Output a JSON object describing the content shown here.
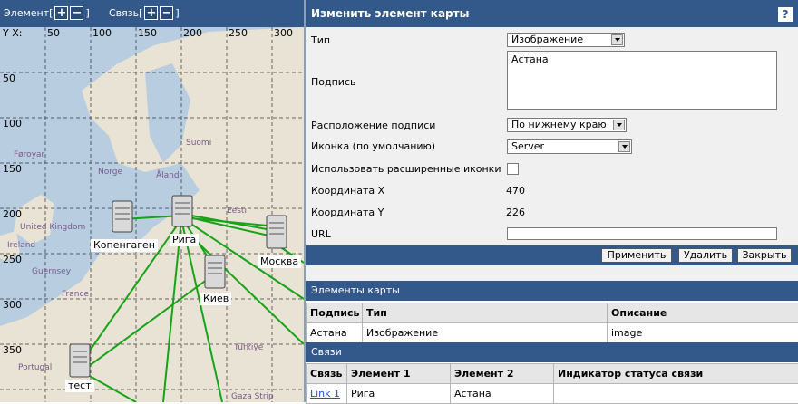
{
  "toolbar": {
    "element_label": "Элемент[",
    "element_add": "+",
    "element_remove": "−",
    "element_close": "]",
    "link_label": "Связь[",
    "link_add": "+",
    "link_remove": "−",
    "link_close": "]"
  },
  "map": {
    "corner_label": "Y X:",
    "x_ticks": [
      "50",
      "100",
      "150",
      "200",
      "250",
      "300"
    ],
    "y_ticks": [
      "50",
      "100",
      "150",
      "200",
      "250",
      "300",
      "350"
    ],
    "place_names": [
      "Føroyar",
      "Norge",
      "Suomi",
      "Eesti",
      "Åland",
      "United Kingdom",
      "Ireland",
      "France",
      "Guernsey",
      "Türkiye",
      "Portugal",
      "Gaza Strip"
    ],
    "nodes": [
      {
        "label": "Копенгаген"
      },
      {
        "label": "Рига"
      },
      {
        "label": "Москва"
      },
      {
        "label": "Киев"
      },
      {
        "label": "тест"
      }
    ]
  },
  "editor": {
    "title": "Изменить элемент карты",
    "help": "?",
    "type_label": "Тип",
    "type_value": "Изображение",
    "caption_label": "Подпись",
    "caption_value": "Астана",
    "caption_pos_label": "Расположение подписи",
    "caption_pos_value": "По нижнему краю",
    "icon_label": "Иконка (по умолчанию)",
    "icon_value": "Server",
    "advanced_icons_label": "Использовать расширенные иконки",
    "x_label": "Координата X",
    "x_value": "470",
    "y_label": "Координата Y",
    "y_value": "226",
    "url_label": "URL",
    "apply": "Применить",
    "delete": "Удалить",
    "close": "Закрыть"
  },
  "elements_section": {
    "title": "Элементы карты",
    "headers": [
      "Подпись",
      "Тип",
      "Описание"
    ],
    "rows": [
      [
        "Астана",
        "Изображение",
        "image"
      ]
    ]
  },
  "links_section": {
    "title": "Связи",
    "headers": [
      "Связь",
      "Элемент 1",
      "Элемент 2",
      "Индикатор статуса связи"
    ],
    "rows": [
      [
        "Link 1",
        "Рига",
        "Астана",
        ""
      ]
    ]
  },
  "colors": {
    "header_bg": "#33588a",
    "link_line": "#16a316",
    "accent_link": "#2050c0"
  },
  "icons": [
    "plus-icon",
    "minus-icon",
    "help-icon",
    "server-icon",
    "dropdown-arrow-icon"
  ]
}
